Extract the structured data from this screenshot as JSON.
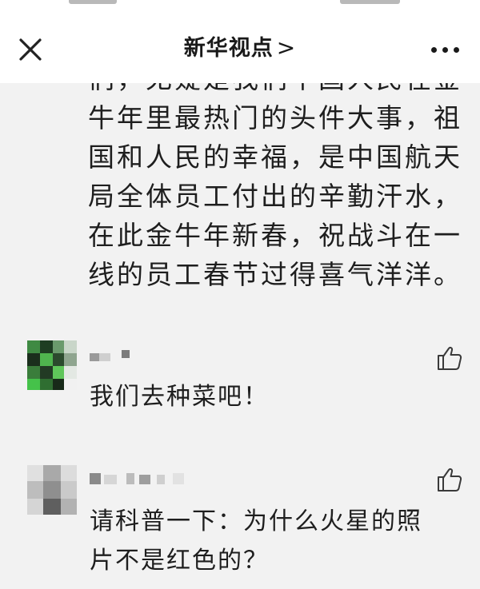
{
  "status_bar": {},
  "nav": {
    "title": "新华视点",
    "title_chevron": ">",
    "close_icon": "close-icon",
    "more_icon": "more-icon"
  },
  "article": {
    "lines": [
      "们，无疑是我们中国人民在金",
      "牛年里最热门的头件大事，祖",
      "国和人民的幸福，是中国航天",
      "局全体员工付出的辛勤汗水，",
      "在此金牛年新春，祝战斗在一",
      "线的员工春节过得喜气洋洋。"
    ]
  },
  "comments": [
    {
      "avatar_style": "pixelated-green",
      "text_lines": [
        "我们去种菜吧！"
      ],
      "like_icon": "thumbs-up-icon"
    },
    {
      "avatar_style": "pixelated-gray",
      "text_lines": [
        "请科普一下：为什么火星的照",
        "片不是红色的？"
      ],
      "like_icon": "thumbs-up-icon"
    }
  ],
  "colors": {
    "page_background": "#f2f2f2",
    "nav_background": "#ffffff",
    "text": "#1e1e1e",
    "icon_stroke": "#3a3a3a"
  }
}
